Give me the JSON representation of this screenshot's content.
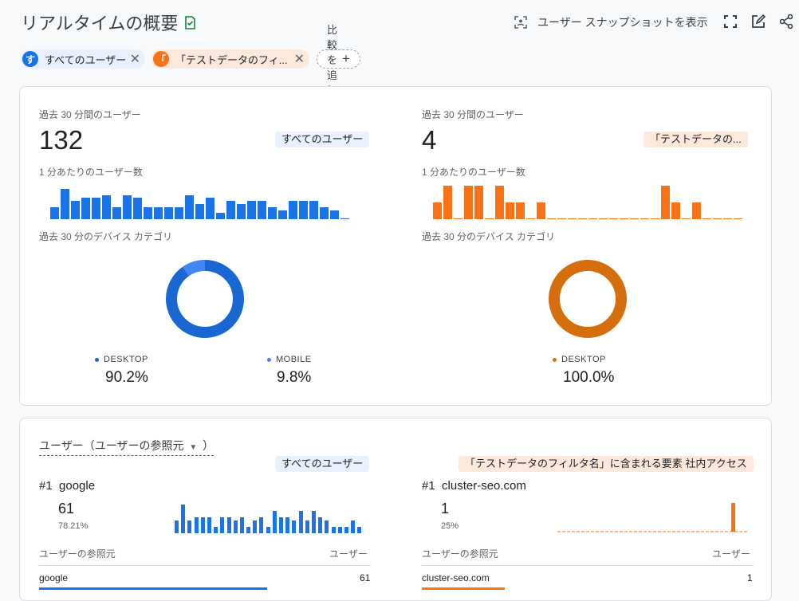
{
  "header": {
    "title": "リアルタイムの概要",
    "snapshot_label": "ユーザー スナップショットを表示",
    "icons": [
      "check-doc-icon",
      "snapshot-icon",
      "fullscreen-icon",
      "edit-icon",
      "share-icon"
    ]
  },
  "chips": [
    {
      "badge": "す",
      "label": "すべてのユーザー",
      "color": "#1a73e8"
    },
    {
      "badge": "「",
      "label": "「テストデータのフィ...",
      "color": "#f97316"
    }
  ],
  "add_compare_label": "比較を追加",
  "summary": {
    "left": {
      "users_label": "過去 30 分間のユーザー",
      "users_value": "132",
      "segment": "すべてのユーザー",
      "per_minute_label": "1 分あたりのユーザー数",
      "per_minute": [
        4,
        10,
        6,
        7,
        7,
        8,
        4,
        8,
        7,
        4,
        4,
        4,
        4,
        8,
        5,
        7,
        2,
        6,
        5,
        6,
        6,
        4,
        3,
        6,
        6,
        6,
        4,
        3,
        0.3
      ],
      "device_label": "過去 30 分のデバイス カテゴリ",
      "devices": [
        {
          "name": "DESKTOP",
          "pct": "90.2%",
          "share": 0.902,
          "color": "#1967d2"
        },
        {
          "name": "MOBILE",
          "pct": "9.8%",
          "share": 0.098,
          "color": "#4285f4"
        }
      ]
    },
    "right": {
      "users_label": "過去 30 分間のユーザー",
      "users_value": "4",
      "segment": "「テストデータの...",
      "per_minute_label": "1 分あたりのユーザー数",
      "per_minute": [
        1,
        2,
        0,
        2,
        2,
        0,
        2,
        1,
        1,
        0,
        1,
        0,
        0,
        0,
        0,
        0,
        0,
        0,
        0,
        0,
        0,
        0,
        2,
        1,
        0,
        1,
        0,
        0,
        0,
        0
      ],
      "device_label": "過去 30 分のデバイス カテゴリ",
      "devices": [
        {
          "name": "DESKTOP",
          "pct": "100.0%",
          "share": 1.0,
          "color": "#d56e0c"
        }
      ]
    }
  },
  "referrers": {
    "title": "ユーザー（ユーザーの参照元",
    "title_close": "）",
    "left": {
      "segment": "すべてのユーザー",
      "rank": "#1",
      "top_name": "google",
      "value": "61",
      "share": "78.21%",
      "bars": [
        4,
        9,
        4,
        5,
        5,
        5,
        2,
        5,
        5,
        4,
        5,
        2,
        4,
        5,
        2,
        7,
        5,
        5,
        4,
        7,
        4,
        7,
        5,
        4,
        2,
        2,
        2,
        4,
        2
      ],
      "col_source": "ユーザーの参照元",
      "col_users": "ユーザー",
      "rows": [
        {
          "name": "google",
          "users": "61",
          "fill": 0.78
        }
      ]
    },
    "right": {
      "segment": "「テストデータのフィルタ名」に含まれる要素 社内アクセス",
      "rank": "#1",
      "top_name": "cluster-seo.com",
      "value": "1",
      "share": "25%",
      "bars": [
        0,
        0,
        0,
        0,
        0,
        0,
        0,
        0,
        0,
        0,
        0,
        0,
        0,
        0,
        0,
        0,
        0,
        0,
        0,
        0,
        0,
        0,
        0,
        0,
        0,
        0,
        0,
        1,
        0,
        0
      ],
      "col_source": "ユーザーの参照元",
      "col_users": "ユーザー",
      "rows": [
        {
          "name": "cluster-seo.com",
          "users": "1",
          "fill": 0.25
        }
      ]
    }
  }
}
